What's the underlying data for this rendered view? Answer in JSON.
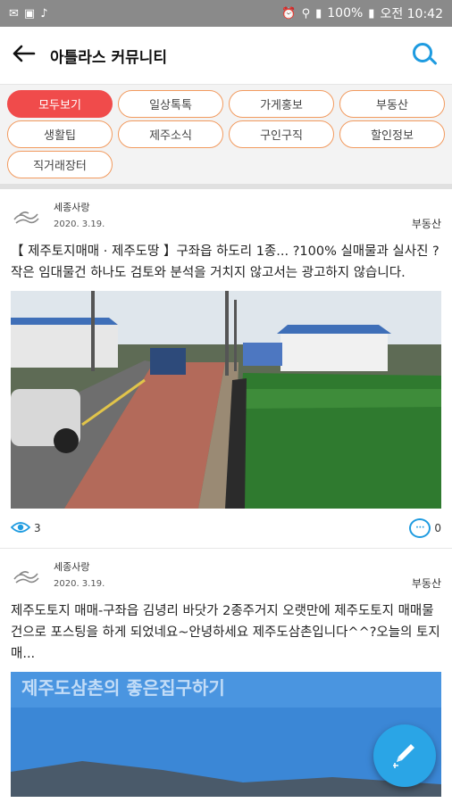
{
  "status_bar": {
    "battery": "100%",
    "time": "오전 10:42"
  },
  "header": {
    "title": "아틀라스 커뮤니티"
  },
  "categories": [
    {
      "label": "모두보기",
      "active": true
    },
    {
      "label": "일상톡톡",
      "active": false
    },
    {
      "label": "가게홍보",
      "active": false
    },
    {
      "label": "부동산",
      "active": false
    },
    {
      "label": "생활팁",
      "active": false
    },
    {
      "label": "제주소식",
      "active": false
    },
    {
      "label": "구인구직",
      "active": false
    },
    {
      "label": "할인정보",
      "active": false
    },
    {
      "label": "직거래장터",
      "active": false
    }
  ],
  "posts": [
    {
      "author": "세종사랑",
      "date": "2020. 3.19.",
      "category": "부동산",
      "text": "【 제주토지매매 · 제주도땅 】구좌읍 하도리 1종... ?100% 실매물과 실사진 ?작은 임대물건 하나도 검토와 분석을 거치지 않고서는 광고하지 않습니다.",
      "views": "3",
      "comments": "0"
    },
    {
      "author": "세종사랑",
      "date": "2020. 3.19.",
      "category": "부동산",
      "text": "제주도토지 매매-구좌읍 김녕리 바닷가 2종주거지 오랫만에 제주도토지 매매물건으로 포스팅을 하게 되었네요~안녕하세요 제주도삼촌입니다^^?오늘의 토지매...",
      "image_caption": "제주도삼촌의 좋은집구하기"
    }
  ],
  "colors": {
    "accent": "#1e9be0",
    "chip_active": "#f04b4b",
    "chip_border": "#f29a5e",
    "fab": "#2aa5e6"
  },
  "icons": [
    "back-arrow-icon",
    "search-icon",
    "eye-icon",
    "comment-icon",
    "pencil-icon"
  ]
}
